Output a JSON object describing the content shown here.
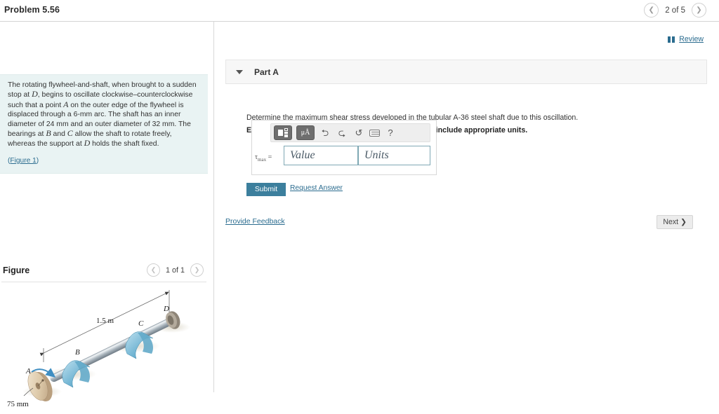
{
  "header": {
    "problem_title": "Problem 5.56",
    "prev_icon": "chevron-left-icon",
    "next_icon": "chevron-right-icon",
    "counter": "2 of 5"
  },
  "left": {
    "statement_parts": {
      "t1": "The rotating flywheel-and-shaft, when brought to a sudden stop at ",
      "v1": "D",
      "t2": ", begins to oscillate clockwise–counterclockwise such that a point ",
      "v2": "A",
      "t3": " on the outer edge of the flywheel is displaced through a 6-mm arc. The shaft has an inner diameter of 24 mm and an outer diameter of 32 mm. The bearings at ",
      "v3": "B",
      "t4": " and ",
      "v4": "C",
      "t5": " allow the shaft to rotate freely, whereas the support at ",
      "v5": "D",
      "t6": " holds the shaft fixed."
    },
    "figure_link_open": "(",
    "figure_link": "Figure 1",
    "figure_link_close": ")",
    "figure_heading": "Figure",
    "figure_counter": "1 of 1",
    "figure_prev_icon": "chevron-left-icon",
    "figure_next_icon": "chevron-right-icon"
  },
  "figure": {
    "labels": {
      "point_a": "A",
      "point_b": "B",
      "point_c": "C",
      "point_d": "D",
      "length": "1.5 m",
      "radius": "75 mm"
    }
  },
  "right": {
    "review_label": "Review",
    "review_icon": "book-icon",
    "part_title": "Part A",
    "collapse_icon": "caret-down-icon",
    "question": "Determine the maximum shear stress developed in the tubular A-36 steel shaft due to this oscillation.",
    "instruction": "Express your answer to three significant figures and include appropriate units.",
    "answer": {
      "equation_symbol": "τ",
      "equation_subscript": "max",
      "equation_equals": "=",
      "value_placeholder": "Value",
      "units_placeholder": "Units",
      "value": "",
      "units": ""
    },
    "toolbar": {
      "template_icon": "math-template-icon",
      "symbols_label": "μÅ",
      "undo_icon": "undo-arrow-icon",
      "redo_icon": "redo-arrow-icon",
      "reset_icon": "reset-circular-arrow-icon",
      "keyboard_icon": "keyboard-icon",
      "help_icon": "question-mark-icon",
      "undo_glyph": "⮌",
      "redo_glyph": "⮎",
      "reset_glyph": "↺",
      "help_glyph": "?"
    },
    "submit_label": "Submit",
    "request_answer_label": "Request Answer",
    "provide_feedback_label": "Provide Feedback",
    "next_label": "Next",
    "next_chevron": "❯"
  },
  "colors": {
    "accent": "#2b6c8f",
    "submit": "#3c7f9d",
    "statement_bg": "#e9f3f3",
    "part_header_bg": "#f7f7f7"
  }
}
